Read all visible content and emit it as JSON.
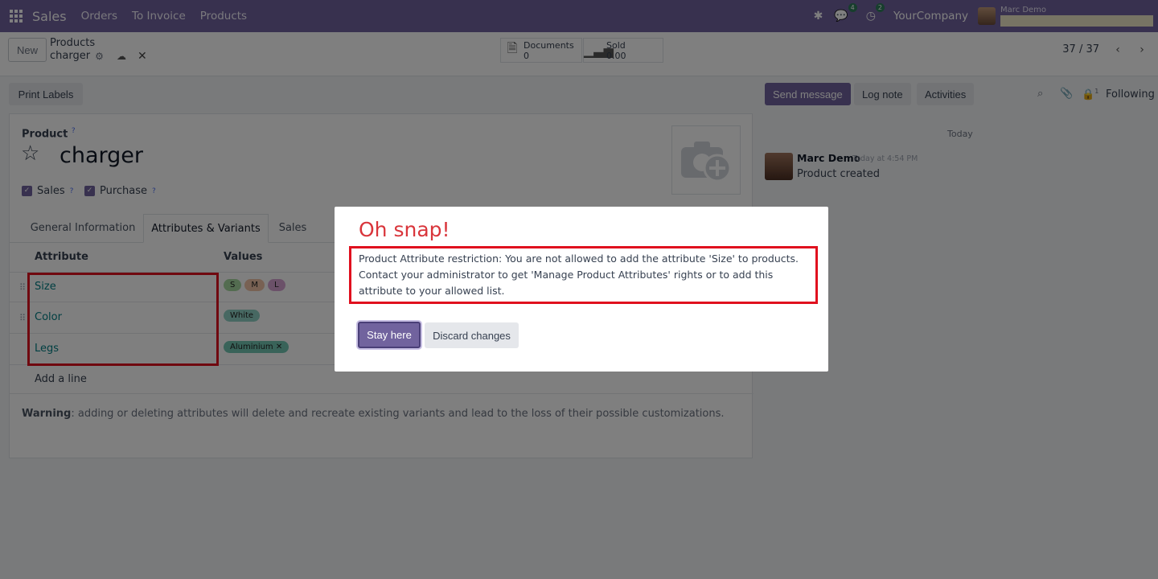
{
  "navbar": {
    "app": "Sales",
    "menu": [
      "Orders",
      "To Invoice",
      "Products"
    ],
    "messages_badge": "4",
    "activities_badge": "2",
    "company": "YourCompany",
    "user": "Marc Demo"
  },
  "control": {
    "new_label": "New",
    "breadcrumb_parent": "Products",
    "breadcrumb_current": "charger",
    "documents_label": "Documents",
    "documents_count": "0",
    "sold_label": "Sold",
    "sold_value": "0.00",
    "pager": "37 / 37"
  },
  "form": {
    "print_labels": "Print Labels",
    "product_label": "Product",
    "help_mark": "?",
    "name": "charger",
    "sales_label": "Sales",
    "purchase_label": "Purchase",
    "tabs": [
      "General Information",
      "Attributes & Variants",
      "Sales"
    ],
    "col_attribute": "Attribute",
    "col_values": "Values",
    "rows": [
      {
        "attr": "Size",
        "values": [
          "S",
          "M",
          "L"
        ]
      },
      {
        "attr": "Color",
        "values": [
          "White"
        ]
      },
      {
        "attr": "Legs",
        "values": [
          "Aluminium ✕"
        ]
      }
    ],
    "add_line": "Add a line",
    "warning_bold": "Warning",
    "warning_text": ": adding or deleting attributes will delete and recreate existing variants and lead to the loss of their possible customizations."
  },
  "chatter": {
    "send_message": "Send message",
    "log_note": "Log note",
    "activities": "Activities",
    "followers_count": "1",
    "following": "Following",
    "today": "Today",
    "author": "Marc Demo",
    "time": "Today at 4:54 PM",
    "message": "Product created"
  },
  "dialog": {
    "title": "Oh snap!",
    "body": "Product Attribute restriction: You are not allowed to add the attribute 'Size' to products. Contact your administrator to get 'Manage Product Attributes' rights or to add this attribute to your allowed list.",
    "stay_here": "Stay here",
    "discard_changes": "Discard changes"
  },
  "colors": {
    "brand": "#71639e",
    "error": "#d9353b",
    "highlight": "#e0101e",
    "link": "#017e84"
  }
}
